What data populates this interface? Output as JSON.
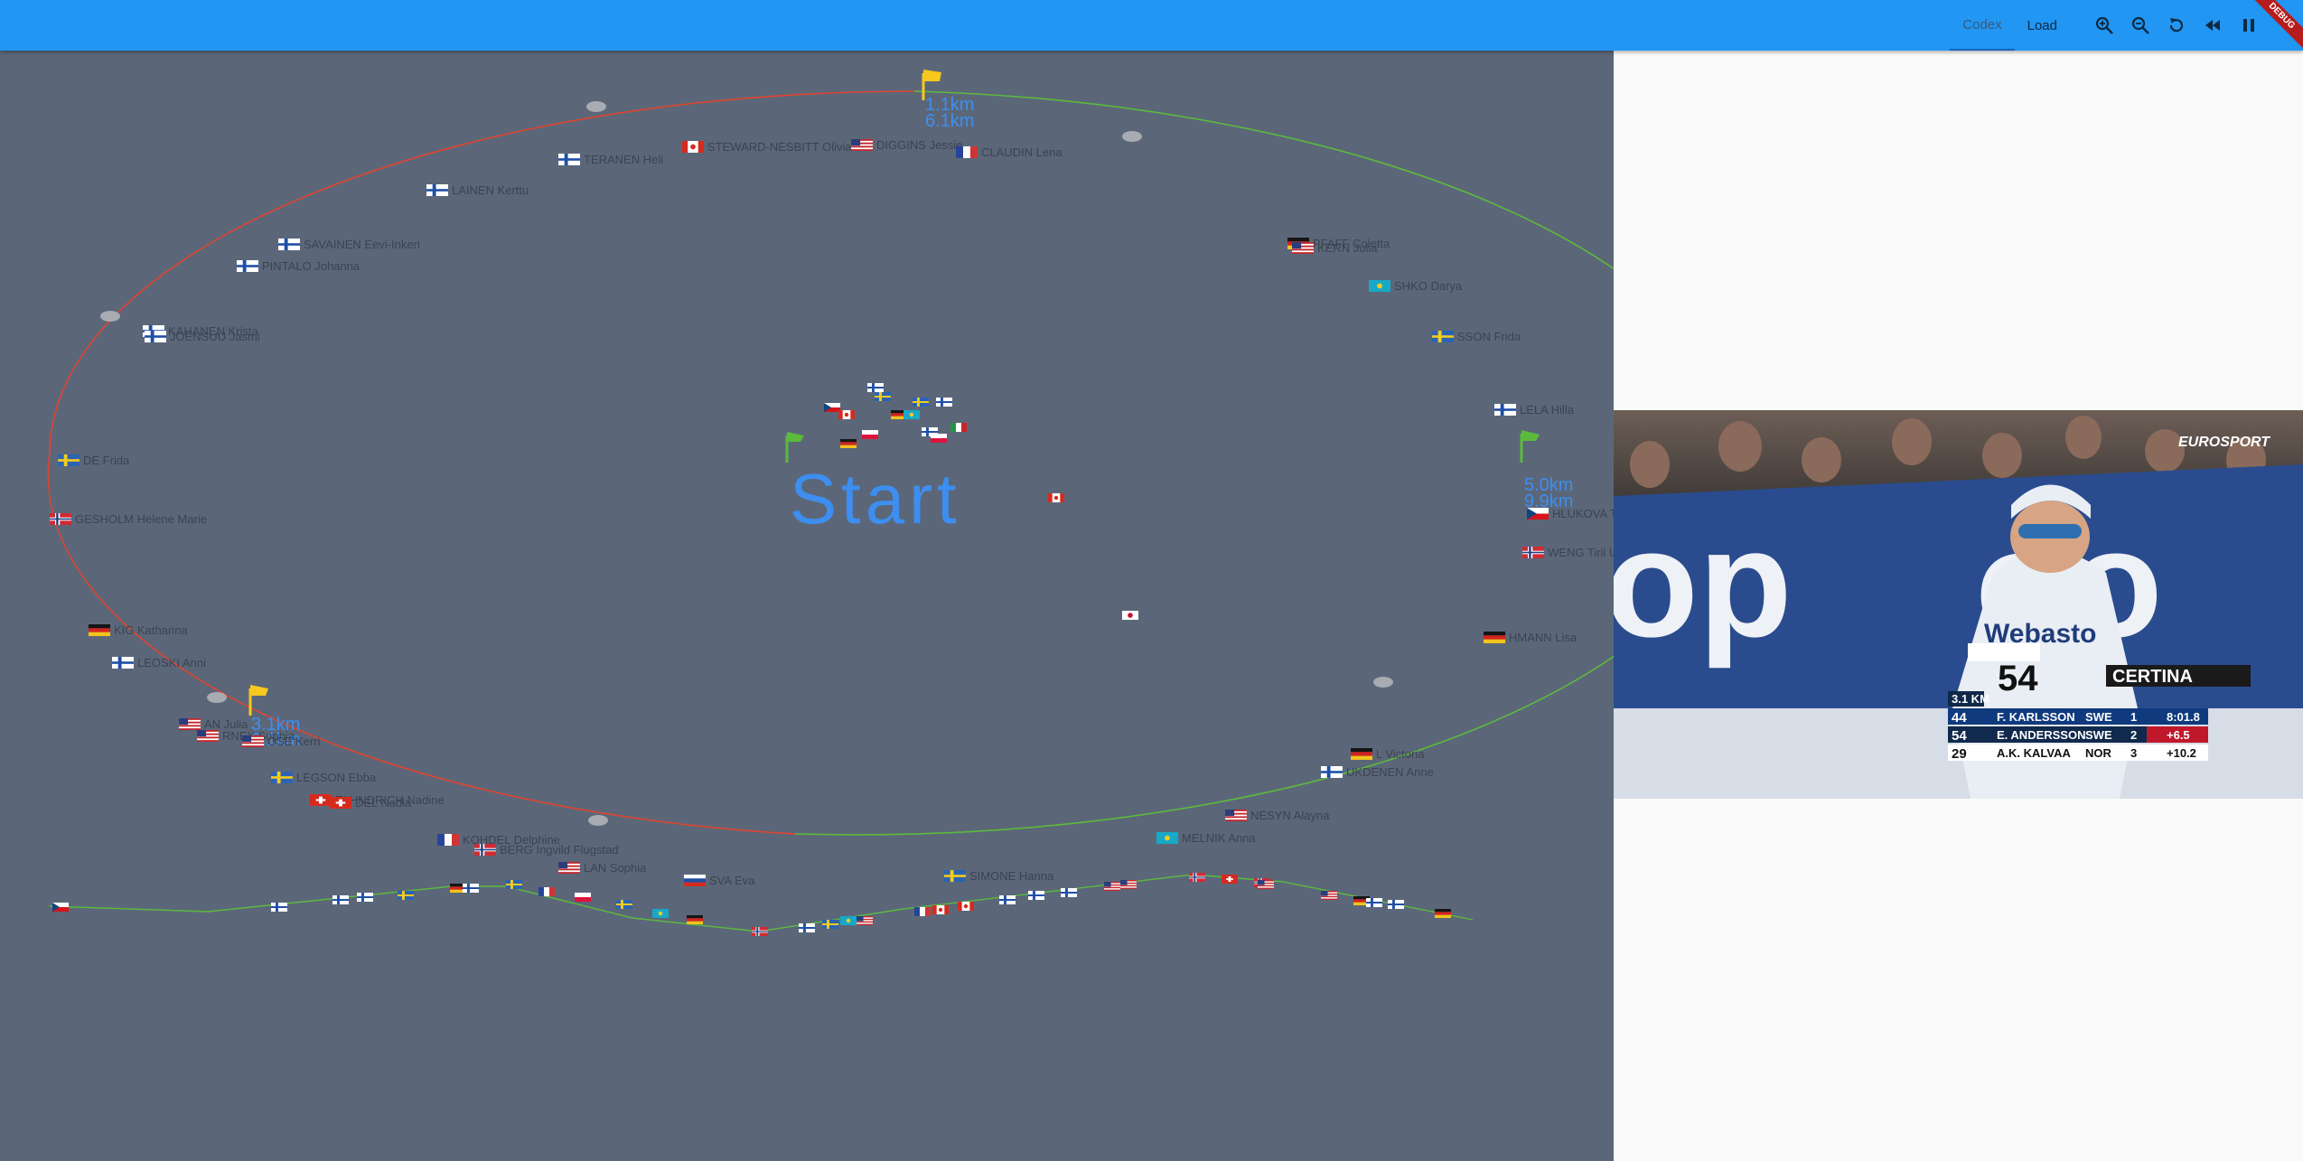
{
  "appbar": {
    "tabs": [
      {
        "label": "Codex",
        "active": true
      },
      {
        "label": "Load",
        "active": false
      }
    ],
    "icons": [
      "zoom-in-icon",
      "zoom-out-icon",
      "replay-icon",
      "rewind-icon",
      "pause-icon"
    ],
    "debug_banner": "DEBUG",
    "color": "#2196f3"
  },
  "track": {
    "start_label": "Start",
    "markers": [
      {
        "km": "1.1km",
        "time": "6.1km",
        "color": "#f7c81e"
      },
      {
        "km": "5.0km",
        "time": "9.9km",
        "color": "#76c442"
      },
      {
        "km": "3.1km",
        "time": "8.1km",
        "color": "#f7c81e"
      },
      {
        "km": "",
        "time": "",
        "color": "#76c442"
      }
    ],
    "athletes": [
      {
        "name": "TERANEN Heli",
        "country": "FIN"
      },
      {
        "name": "STEWARD-NESBITT Olivia",
        "country": "CAN"
      },
      {
        "name": "DIGGINS Jessie",
        "country": "USA"
      },
      {
        "name": "CLAUDIN Lena",
        "country": "FRA"
      },
      {
        "name": "LAINEN Kerttu",
        "country": "FIN"
      },
      {
        "name": "SAVAINEN Eevi-Inkeri",
        "country": "FIN"
      },
      {
        "name": "PINTALO Johanna",
        "country": "FIN"
      },
      {
        "name": "KAHANEN Krista",
        "country": "FIN"
      },
      {
        "name": "JOENSUU Jasmi",
        "country": "FIN"
      },
      {
        "name": "DE Frida",
        "country": "SWE"
      },
      {
        "name": "GESHOLM Helene Marie",
        "country": "NOR"
      },
      {
        "name": "KIG Katharina",
        "country": "GER"
      },
      {
        "name": "LEOSKI Anni",
        "country": "FIN"
      },
      {
        "name": "AN Julia",
        "country": "USA"
      },
      {
        "name": "RNEY Sophia",
        "country": "USA"
      },
      {
        "name": "OSE Kerri",
        "country": "USA"
      },
      {
        "name": "LEGSON Ebba",
        "country": "SWE"
      },
      {
        "name": "FAHNDRICH Nadine",
        "country": "SUI"
      },
      {
        "name": "DEL Nadia",
        "country": "SUI"
      },
      {
        "name": "KOHDEL Delphine",
        "country": "FRA"
      },
      {
        "name": "BERG Ingvild Flugstad",
        "country": "NOR"
      },
      {
        "name": "LAN Sophia",
        "country": "USA"
      },
      {
        "name": "SVA Eva",
        "country": "SVK"
      },
      {
        "name": "SIMONE Hanna",
        "country": "SWE"
      },
      {
        "name": "MELNIK Anna",
        "country": "KAZ"
      },
      {
        "name": "NESYN Alayna",
        "country": "USA"
      },
      {
        "name": "UKDENEN Anne",
        "country": "FIN"
      },
      {
        "name": "L Victoria",
        "country": "GER"
      },
      {
        "name": "HMANN Lisa",
        "country": "GER"
      },
      {
        "name": "HLUKOVA Tereza",
        "country": "CZE"
      },
      {
        "name": "WENG Tiril Udnes",
        "country": "NOR"
      },
      {
        "name": "LELA Hilla",
        "country": "FIN"
      },
      {
        "name": "SSON Frida",
        "country": "SWE"
      },
      {
        "name": "SHKO Darya",
        "country": "KAZ"
      },
      {
        "name": "PFAFF Coletta",
        "country": "GER"
      },
      {
        "name": "KERN Julia",
        "country": "USA"
      }
    ]
  },
  "video": {
    "channel": "EUROSPORT",
    "sponsor": "CERTINA",
    "banner_text": "Webasto",
    "bib": "54",
    "split_label": "3.1 KM",
    "results": [
      {
        "bib": "44",
        "name": "F. KARLSSON",
        "nation": "SWE",
        "rank": "1",
        "time": "8:01.8"
      },
      {
        "bib": "54",
        "name": "E. ANDERSSON",
        "nation": "SWE",
        "rank": "2",
        "time": "+6.5"
      },
      {
        "bib": "29",
        "name": "A.K. KALVAA",
        "nation": "NOR",
        "rank": "3",
        "time": "+10.2"
      }
    ]
  }
}
